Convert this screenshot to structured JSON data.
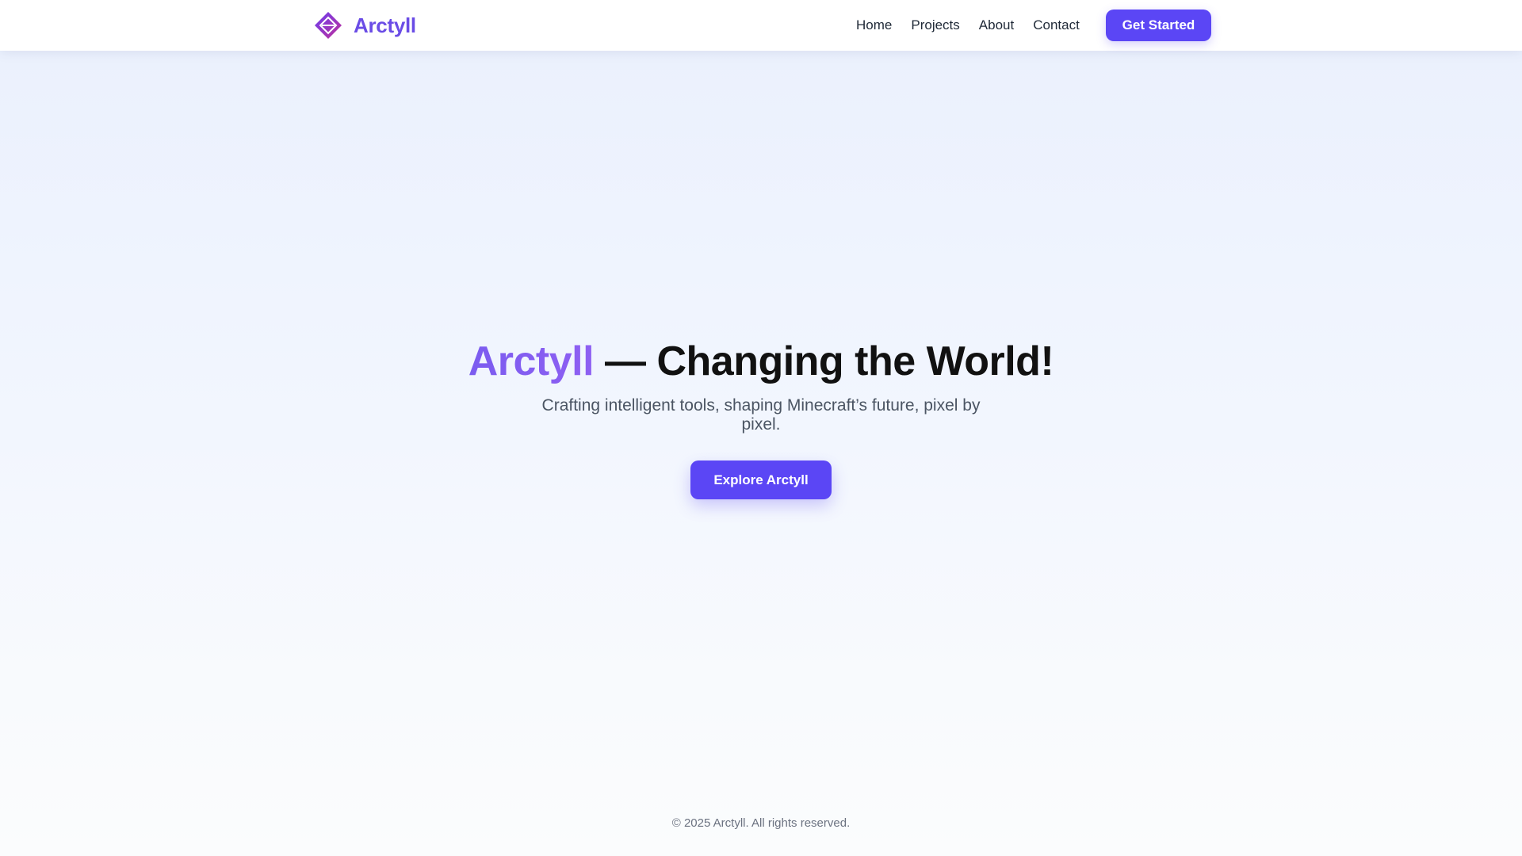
{
  "header": {
    "brand_name": "Arctyll",
    "nav": [
      {
        "label": "Home"
      },
      {
        "label": "Projects"
      },
      {
        "label": "About"
      },
      {
        "label": "Contact"
      }
    ],
    "cta_label": "Get Started"
  },
  "hero": {
    "title_accent": "Arctyll",
    "title_rest": " — Changing the World!",
    "subtitle": "Crafting intelligent tools, shaping Minecraft’s future, pixel by pixel.",
    "cta_label": "Explore Arctyll"
  },
  "footer": {
    "copyright": "© 2025 Arctyll. All rights reserved."
  },
  "icons": {
    "brand_logo": "diamond-logo-icon"
  },
  "colors": {
    "brand": "#6a4ce6",
    "primary_button": "#5b46f5",
    "logo_gradient_start": "#6b3df0",
    "logo_gradient_end": "#c0309a",
    "background_top": "#eaf0fd",
    "background_bottom": "#fbfcfd",
    "heading_text": "#111111",
    "body_text": "#4b5563"
  }
}
